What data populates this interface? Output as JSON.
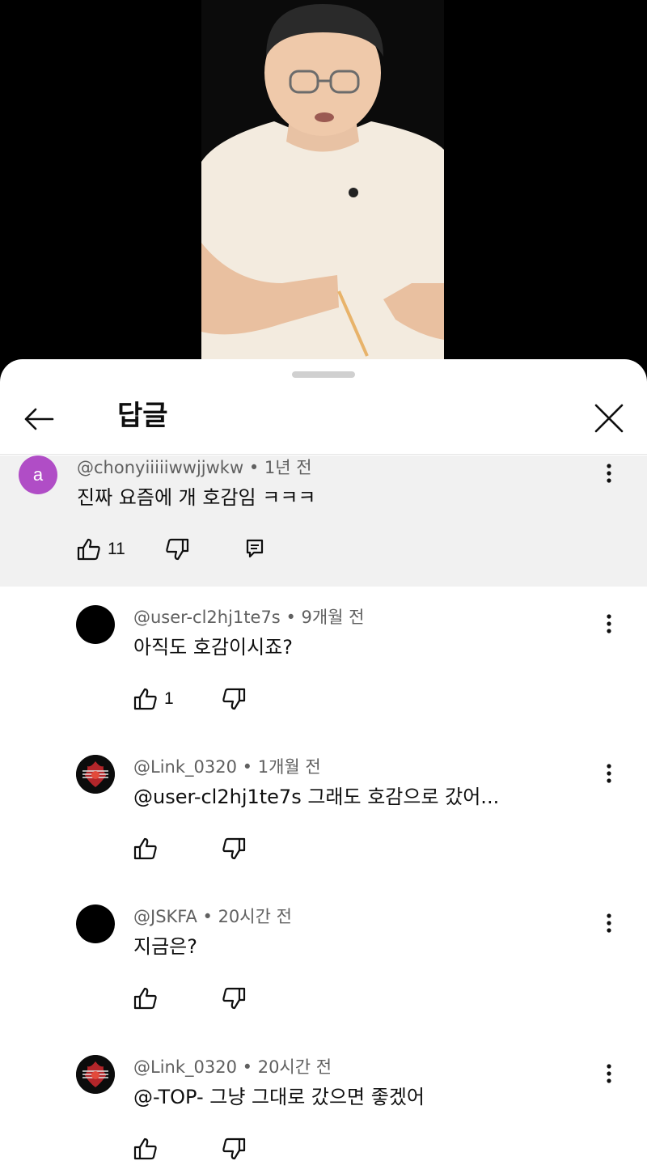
{
  "header": {
    "title": "답글"
  },
  "colors": {
    "highlight_bg": "#f1f1f1",
    "avatar_a": "#b04dc6"
  },
  "icons": {
    "back": "arrow-left-icon",
    "close": "close-icon",
    "like": "thumb-up-icon",
    "dislike": "thumb-down-icon",
    "reply": "reply-icon",
    "menu": "more-vert-icon"
  },
  "parent_comment": {
    "avatar_letter": "a",
    "author": "@chonyiiiiiwwjjwkw",
    "time": "1년 전",
    "text": "진짜 요즘에 개 호감임 ㅋㅋㅋ",
    "likes": "11"
  },
  "replies": [
    {
      "author": "@user-cl2hj1te7s",
      "time": "9개월 전",
      "text": "아직도 호감이시죠?",
      "likes": "1"
    },
    {
      "author": "@Link_0320",
      "time": "1개월 전",
      "text": " @user-cl2hj1te7s 그래도 호감으로 갔어...",
      "likes": ""
    },
    {
      "author": "@JSKFA",
      "time": "20시간 전",
      "text": "지금은?",
      "likes": ""
    },
    {
      "author": "@Link_0320",
      "time": "20시간 전",
      "text": " @-TOP-  그냥 그대로 갔으면 좋겠어",
      "likes": ""
    }
  ]
}
